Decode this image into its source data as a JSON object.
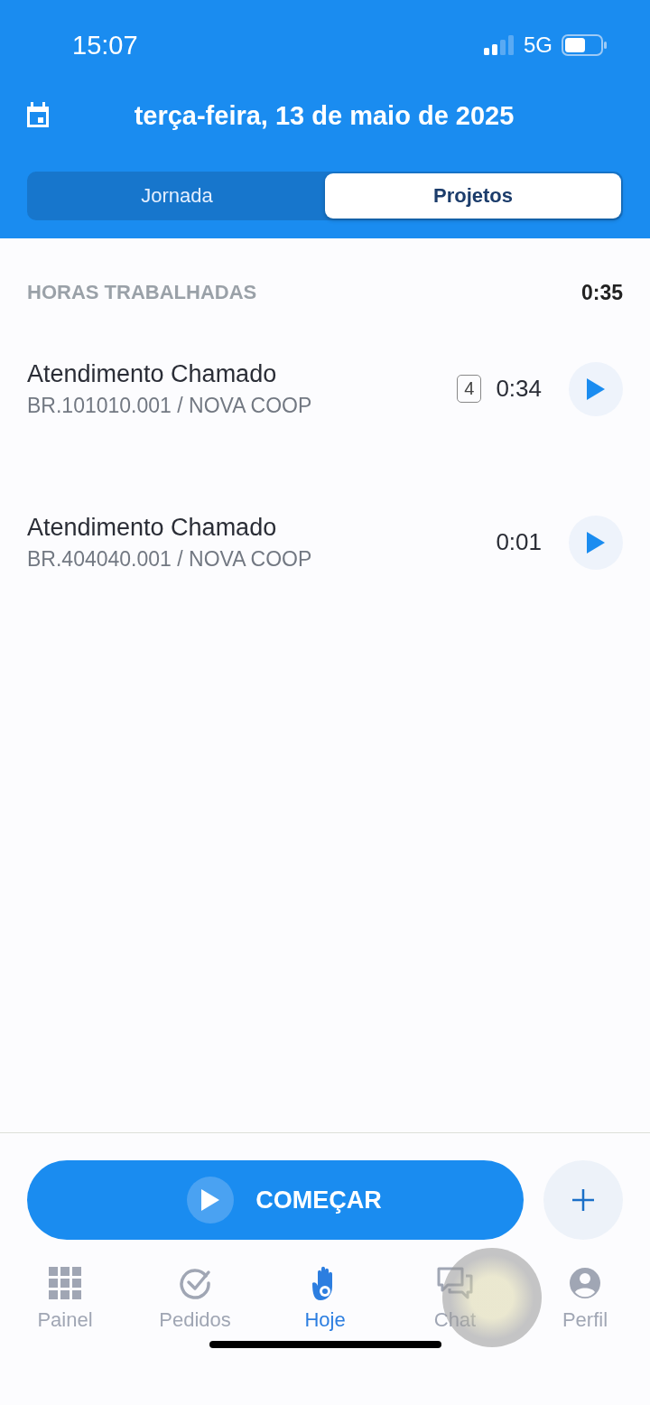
{
  "status_bar": {
    "time": "15:07",
    "network": "5G"
  },
  "header": {
    "date": "terça-feira, 13 de maio de 2025"
  },
  "tabs": [
    {
      "label": "Jornada",
      "selected": false
    },
    {
      "label": "Projetos",
      "selected": true
    }
  ],
  "summary": {
    "label": "HORAS TRABALHADAS",
    "total": "0:35"
  },
  "entries": [
    {
      "title": "Atendimento Chamado",
      "code": "BR.101010.001 / NOVA COOP",
      "count": "4",
      "time": "0:34"
    },
    {
      "title": "Atendimento Chamado",
      "code": "BR.404040.001 / NOVA COOP",
      "time": "0:01"
    }
  ],
  "start_button": {
    "label": "COMEÇAR"
  },
  "nav": [
    {
      "label": "Painel",
      "kind": "grid",
      "selected": false
    },
    {
      "label": "Pedidos",
      "kind": "check",
      "selected": false
    },
    {
      "label": "Hoje",
      "kind": "hand",
      "selected": true
    },
    {
      "label": "Chat",
      "kind": "chat",
      "selected": false
    },
    {
      "label": "Perfil",
      "kind": "person",
      "selected": false
    }
  ]
}
